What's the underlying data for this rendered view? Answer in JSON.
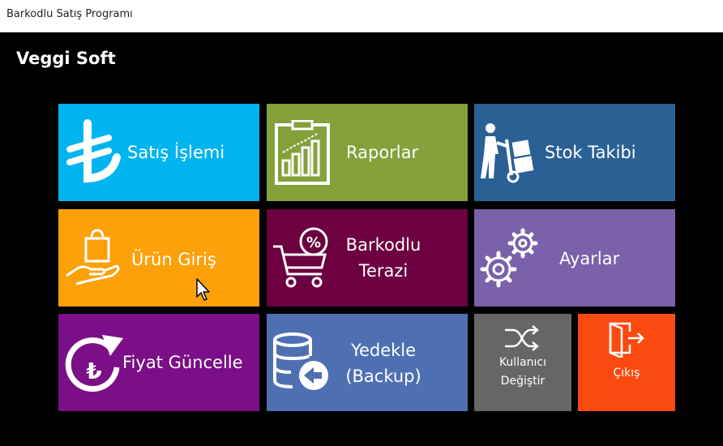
{
  "window": {
    "title": "Barkodlu Satış Programı"
  },
  "app": {
    "brand": "Veggi Soft"
  },
  "tiles": {
    "satis": {
      "label": "Satış İşlemi",
      "color": "#00b4f0",
      "icon": "turkish-lira-icon"
    },
    "raporlar": {
      "label": "Raporlar",
      "color": "#84a13a",
      "icon": "report-chart-icon"
    },
    "stok": {
      "label": "Stok Takibi",
      "color": "#2b6094",
      "icon": "hand-truck-icon"
    },
    "urun": {
      "label": "Ürün Giriş",
      "color": "#fca10a",
      "icon": "hand-bag-icon"
    },
    "terazi": {
      "label_line1": "Barkodlu",
      "label_line2": "Terazi",
      "color": "#6c0040",
      "icon": "cart-discount-icon"
    },
    "ayarlar": {
      "label": "Ayarlar",
      "color": "#7b60aa",
      "icon": "gears-icon"
    },
    "fiyat": {
      "label": "Fiyat Güncelle",
      "color": "#7a0f87",
      "icon": "lira-refresh-icon"
    },
    "yedekle": {
      "label_line1": "Yedekle",
      "label_line2": "(Backup)",
      "color": "#4e6fb2",
      "icon": "database-backup-icon"
    },
    "kullanici": {
      "label_line1": "Kullanıcı",
      "label_line2": "Değiştir",
      "color": "#666666",
      "icon": "shuffle-icon"
    },
    "cikis": {
      "label": "Çıkış",
      "color": "#fb4a10",
      "icon": "exit-door-icon"
    }
  }
}
